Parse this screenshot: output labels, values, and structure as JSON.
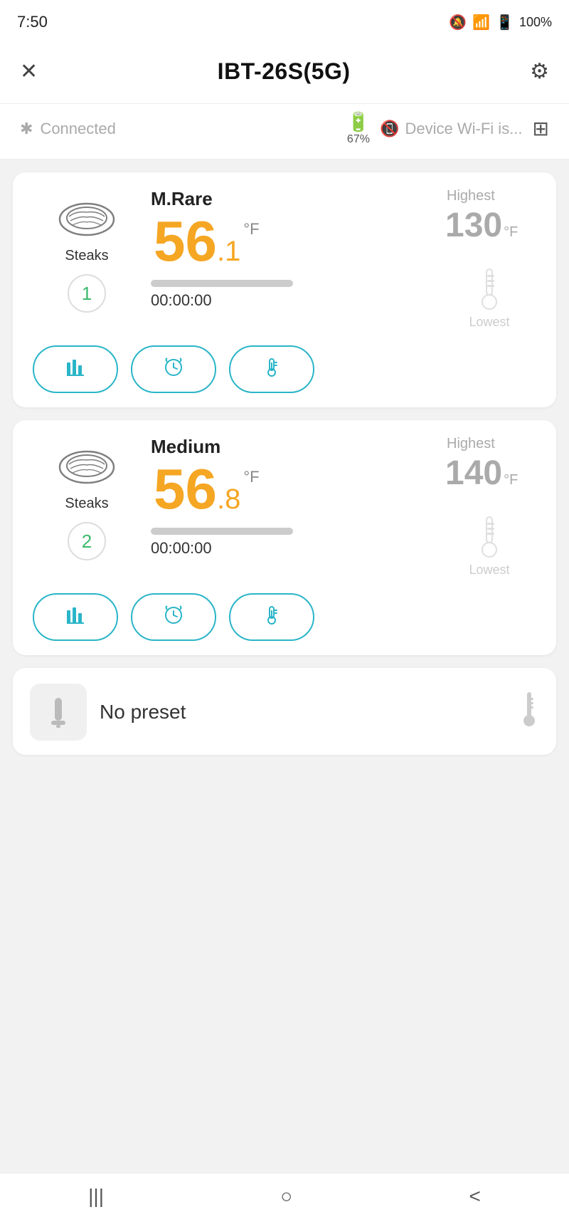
{
  "statusBar": {
    "time": "7:50",
    "batteryPct": "100%"
  },
  "topNav": {
    "title": "IBT-26S(5G)",
    "closeLabel": "✕",
    "settingsLabel": "⚙"
  },
  "deviceInfo": {
    "batteryPct": "67%",
    "connectedText": "Connected",
    "wifiText": "Device Wi-Fi is...",
    "gridIconLabel": "⊞"
  },
  "probes": [
    {
      "id": 1,
      "foodType": "Steaks",
      "presetName": "M.Rare",
      "tempWhole": "56",
      "tempDecimal": ".1",
      "tempUnit": "°F",
      "highestLabel": "Highest",
      "highestTemp": "130",
      "highestUnit": "°F",
      "lowestLabel": "Lowest",
      "timer": "00:00:00",
      "progressPct": 0,
      "probeNumber": "1",
      "btn1": "chart",
      "btn2": "timer",
      "btn3": "thermometer"
    },
    {
      "id": 2,
      "foodType": "Steaks",
      "presetName": "Medium",
      "tempWhole": "56",
      "tempDecimal": ".8",
      "tempUnit": "°F",
      "highestLabel": "Highest",
      "highestTemp": "140",
      "highestUnit": "°F",
      "lowestLabel": "Lowest",
      "timer": "00:00:00",
      "progressPct": 0,
      "probeNumber": "2",
      "btn1": "chart",
      "btn2": "timer",
      "btn3": "thermometer"
    }
  ],
  "noPreset": {
    "label": "No preset"
  },
  "bottomNav": {
    "backIcon": "|||",
    "homeIcon": "○",
    "forwardIcon": "<"
  }
}
